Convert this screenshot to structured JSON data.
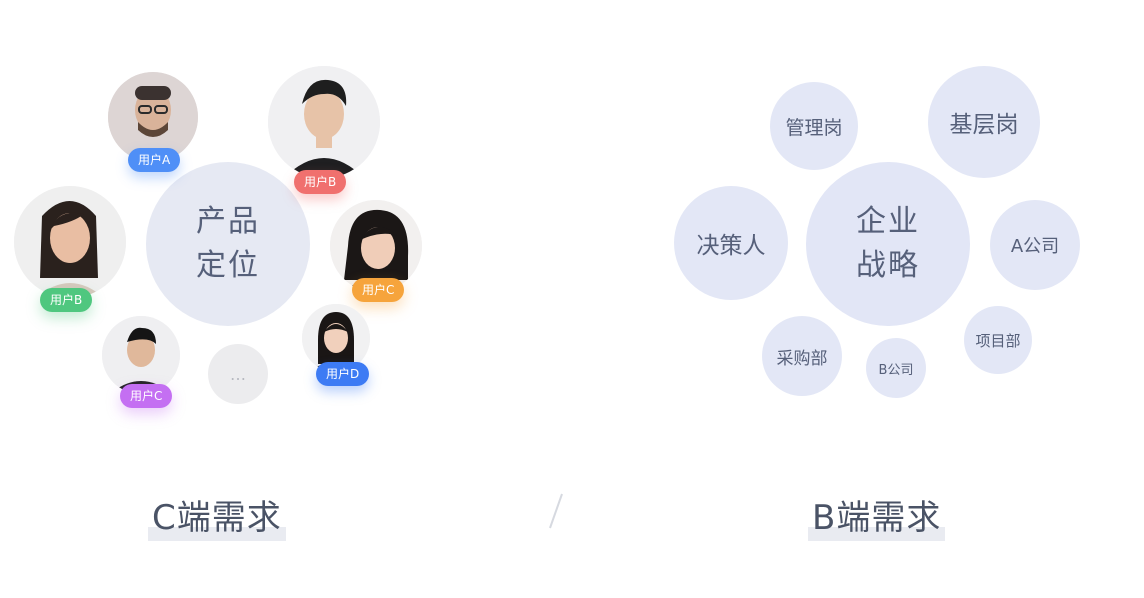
{
  "left": {
    "center": {
      "line1": "产品",
      "line2": "定位"
    },
    "users": [
      {
        "label": "用户A",
        "color": "#4f8ff7"
      },
      {
        "label": "用户B",
        "color": "#f0706e"
      },
      {
        "label": "用户B",
        "color": "#4fc77f"
      },
      {
        "label": "用户C",
        "color": "#f6a43c"
      },
      {
        "label": "用户C",
        "color": "#c46ff2"
      },
      {
        "label": "用户D",
        "color": "#3d7bf4"
      }
    ],
    "more": "…",
    "footer": "C端需求"
  },
  "right": {
    "center": {
      "line1": "企业",
      "line2": "战略"
    },
    "nodes": {
      "guanli": "管理岗",
      "jiceng": "基层岗",
      "juece": "决策人",
      "acompany": "A公司",
      "caigou": "采购部",
      "bcompany": "B公司",
      "xiangmu": "项目部"
    },
    "footer": "B端需求"
  },
  "divider": "/"
}
